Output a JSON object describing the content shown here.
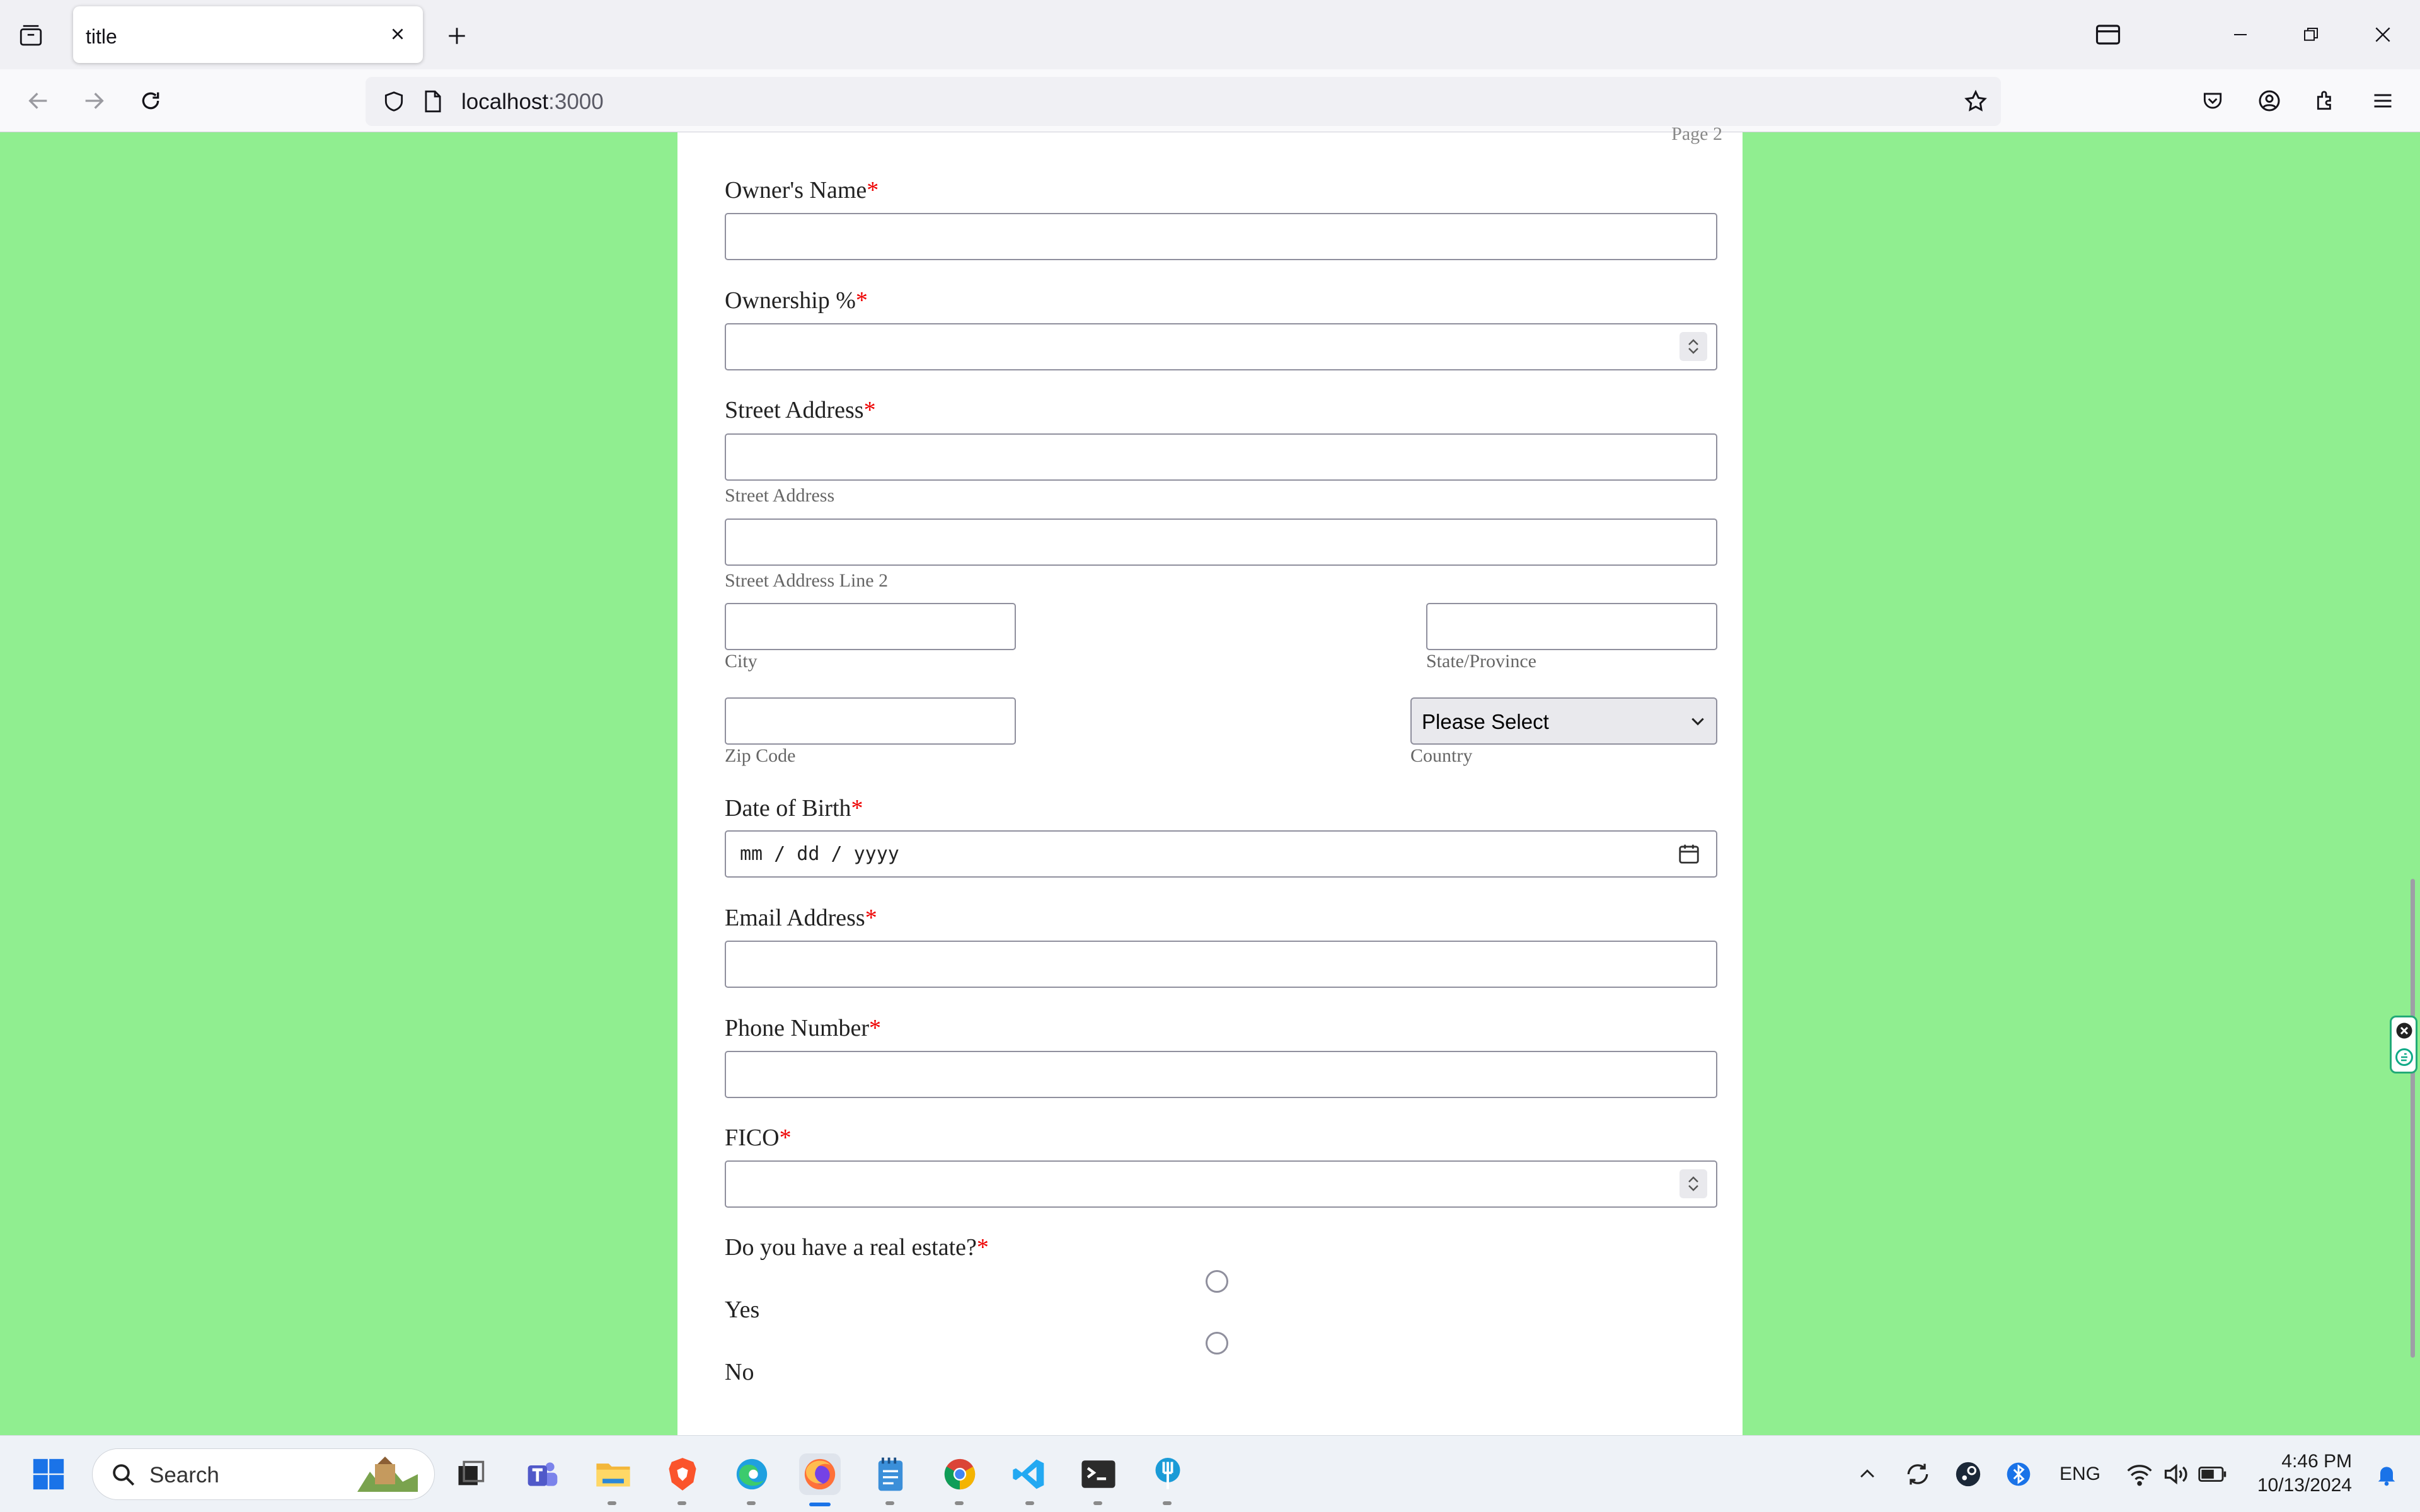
{
  "browser": {
    "tab_title": "title",
    "url_host": "localhost",
    "url_port": ":3000"
  },
  "form": {
    "page_indicator": "Page 2",
    "required_mark": "*",
    "owners_name_label": "Owner's Name",
    "ownership_label": "Ownership %",
    "street_address_label": "Street Address",
    "street_address_sub": "Street Address",
    "street_address2_sub": "Street Address Line 2",
    "city_sub": "City",
    "state_sub": "State/Province",
    "zip_sub": "Zip Code",
    "country_sub": "Country",
    "country_select_value": "Please Select",
    "dob_label": "Date of Birth",
    "dob_placeholder": "mm / dd / yyyy",
    "email_label": "Email Address",
    "phone_label": "Phone Number",
    "fico_label": "FICO",
    "real_estate_label": "Do you have a real estate?",
    "option_yes": "Yes",
    "option_no": "No"
  },
  "taskbar": {
    "search_placeholder": "Search",
    "language": "ENG",
    "time": "4:46 PM",
    "date": "10/13/2024"
  }
}
